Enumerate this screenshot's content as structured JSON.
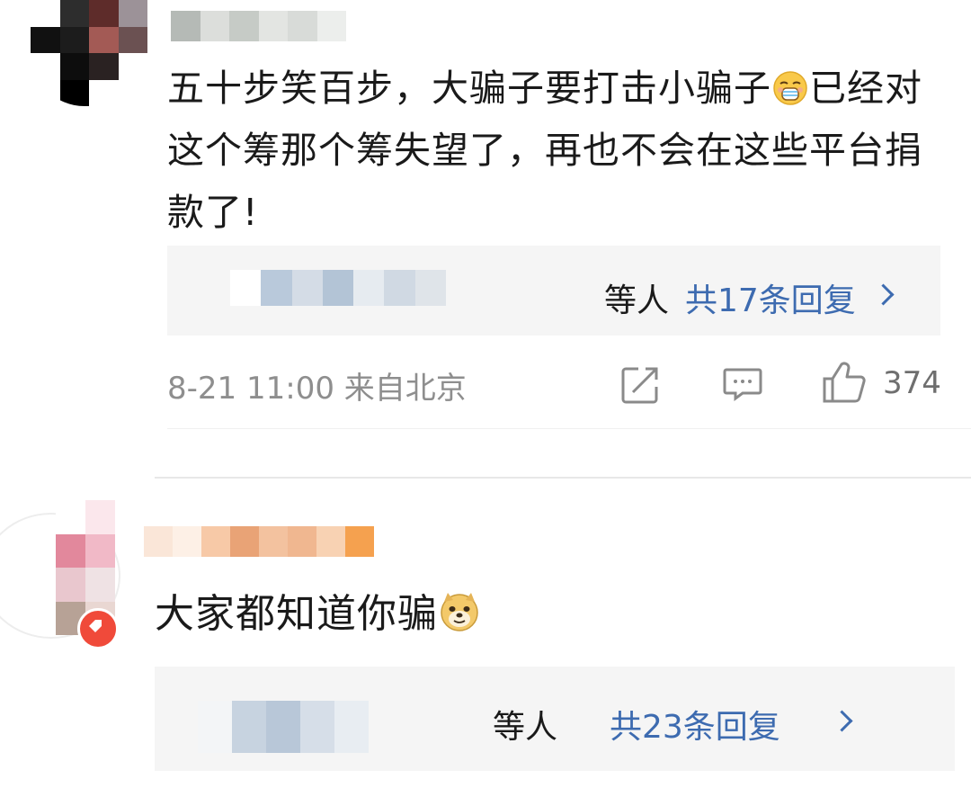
{
  "comments": [
    {
      "text_before_emoji": "五十步笑百步，大骗子要打击小骗子",
      "emoji": "weeping-face-icon",
      "text_after_emoji": "已经对这个筹那个筹失望了，再也不会在这些平台捐款了!",
      "reply_summary": {
        "suffix": "等人",
        "count_label": "共17条回复"
      },
      "meta": "8-21 11:00 来自北京",
      "like_count": "374"
    },
    {
      "text": "大家都知道你骗",
      "emoji": "doge-icon",
      "reply_summary": {
        "suffix": "等人",
        "count_label": "共23条回复"
      }
    }
  ],
  "colors": {
    "link": "#3d6bb0",
    "meta": "#8e8e8e",
    "reply_bg": "#f5f5f5",
    "text": "#1a1a1a",
    "badge": "#f04a3a"
  }
}
